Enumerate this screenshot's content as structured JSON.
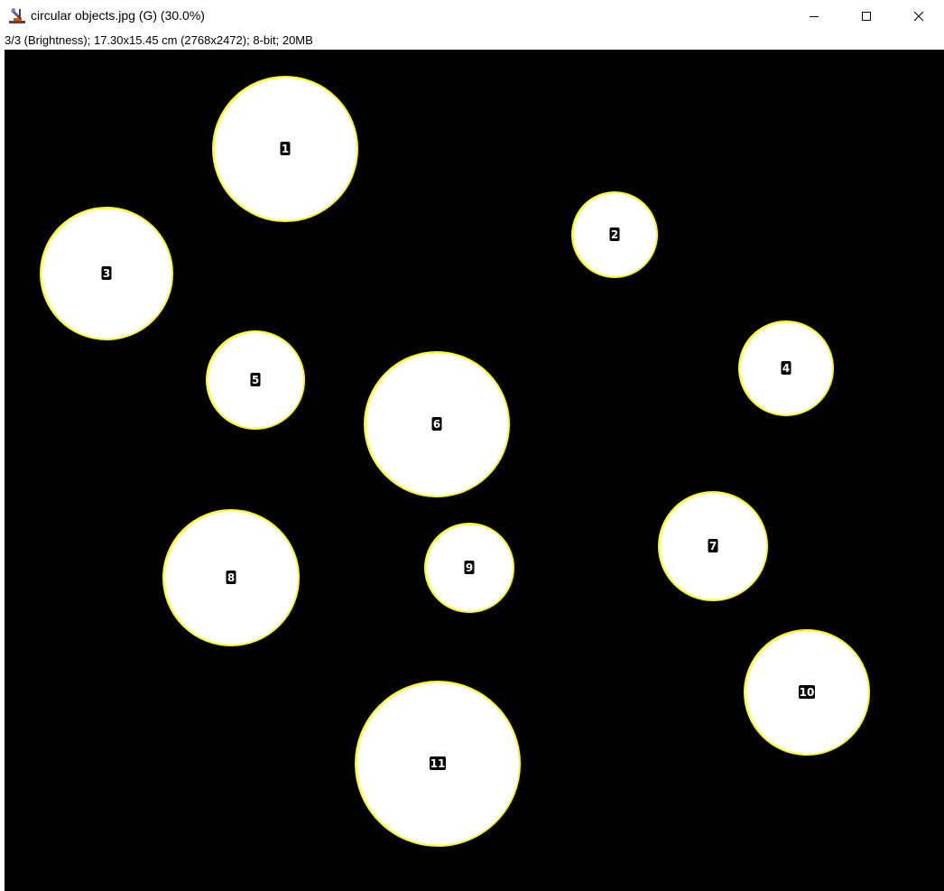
{
  "window": {
    "title": "circular objects.jpg (G) (30.0%)",
    "info": "3/3 (Brightness); 17.30x15.45 cm (2768x2472); 8-bit; 20MB",
    "app_icon": "imagej-microscope-icon",
    "controls": {
      "minimize_icon": "minimize-icon",
      "maximize_icon": "maximize-icon",
      "close_icon": "close-icon"
    }
  },
  "image": {
    "background_color": "#000000",
    "object_fill": "#ffffff",
    "outline_color": "#ffff00",
    "label_background": "#000000",
    "label_text_color": "#ffffff",
    "objects": [
      {
        "label": "1"
      },
      {
        "label": "2"
      },
      {
        "label": "3"
      },
      {
        "label": "4"
      },
      {
        "label": "5"
      },
      {
        "label": "6"
      },
      {
        "label": "7"
      },
      {
        "label": "8"
      },
      {
        "label": "9"
      },
      {
        "label": "10"
      },
      {
        "label": "11"
      }
    ]
  }
}
